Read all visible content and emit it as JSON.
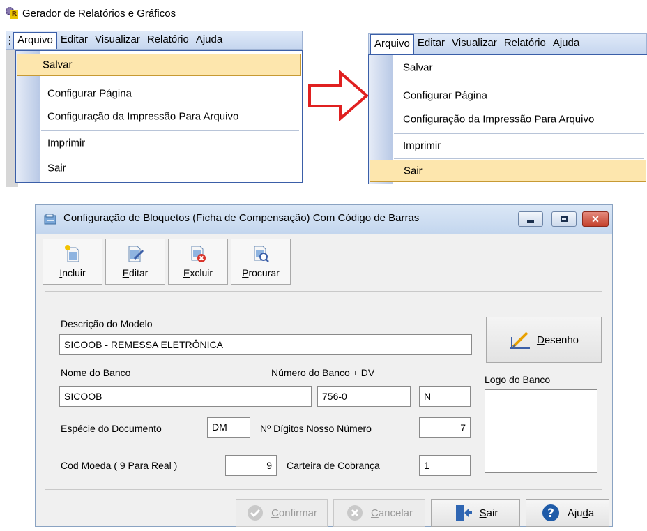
{
  "app": {
    "title": "Gerador de Relatórios e Gráficos"
  },
  "menubar": {
    "items": [
      "Arquivo",
      "Editar",
      "Visualizar",
      "Relatório",
      "Ajuda"
    ]
  },
  "file_menu": {
    "items": [
      "Salvar",
      "Configurar Página",
      "Configuração da Impressão Para Arquivo",
      "Imprimir",
      "Sair"
    ]
  },
  "left_menu_state": {
    "highlighted": "Salvar"
  },
  "right_menu_state": {
    "highlighted": "Sair"
  },
  "dialog": {
    "title": "Configuração de Bloquetos (Ficha de Compensação) Com Código de Barras",
    "toolbar": {
      "incluir": {
        "underline": "I",
        "rest": "ncluir"
      },
      "editar": {
        "underline": "E",
        "rest": "ditar"
      },
      "excluir": {
        "underline": "E",
        "rest": "xcluir"
      },
      "procurar": {
        "underline": "P",
        "rest": "rocurar"
      }
    },
    "form": {
      "descricao_label": "Descrição do Modelo",
      "descricao_value": "SICOOB - REMESSA ELETRÔNICA",
      "nome_banco_label": "Nome do Banco",
      "nome_banco_value": "SICOOB",
      "numero_banco_label": "Número do Banco + DV",
      "numero_banco_value": "756-0",
      "numero_banco_flag": "N",
      "especie_label": "Espécie do Documento",
      "especie_value": "DM",
      "digitos_label": "Nº Dígitos Nosso Número",
      "digitos_value": "7",
      "cod_moeda_label": "Cod Moeda ( 9 Para Real )",
      "cod_moeda_value": "9",
      "carteira_label": "Carteira de Cobrança",
      "carteira_value": "1",
      "logo_label": "Logo do Banco",
      "desenho": {
        "underline": "D",
        "rest": "esenho"
      }
    },
    "buttons": {
      "confirmar": {
        "underline": "C",
        "rest": "onfirmar"
      },
      "cancelar": {
        "underline": "C",
        "rest": "ancelar"
      },
      "sair": {
        "underline": "S",
        "rest": "air"
      },
      "ajuda": {
        "pre": "Aju",
        "underline": "d",
        "rest": "a"
      }
    }
  },
  "colors": {
    "highlight_fill": "#fde6ad",
    "highlight_border": "#c79a34",
    "arrow": "#e02020",
    "menubar": "#c6d6ef"
  }
}
